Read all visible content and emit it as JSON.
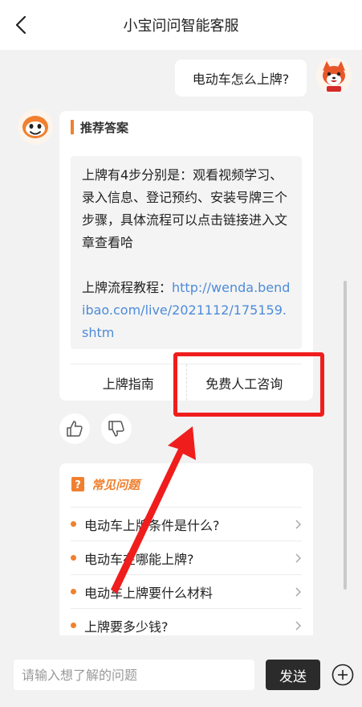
{
  "header": {
    "title": "小宝问问智能客服"
  },
  "chat": {
    "user_message": "电动车怎么上牌?",
    "answer": {
      "title": "推荐答案",
      "text": "上牌有4步分别是：观看视频学习、录入信息、登记预约、安装号牌三个步骤，具体流程可以点击链接进入文章查看哈",
      "link_label": "上牌流程教程：",
      "link_url": "http://wenda.bendibao.com/live/2021112/175159.shtm",
      "buttons": [
        "上牌指南",
        "免费人工咨询"
      ]
    },
    "faq": {
      "title": "常见问题",
      "items": [
        "电动车上牌条件是什么?",
        "电动车在哪能上牌?",
        "电动车上牌要什么材料",
        "上牌要多少钱?"
      ]
    }
  },
  "input": {
    "placeholder": "请输入想了解的问题",
    "send_label": "发送"
  },
  "colors": {
    "accent": "#f0802f",
    "link": "#4d8bd9",
    "annotation": "#f01d1d",
    "send_button": "#2b2b2b"
  }
}
